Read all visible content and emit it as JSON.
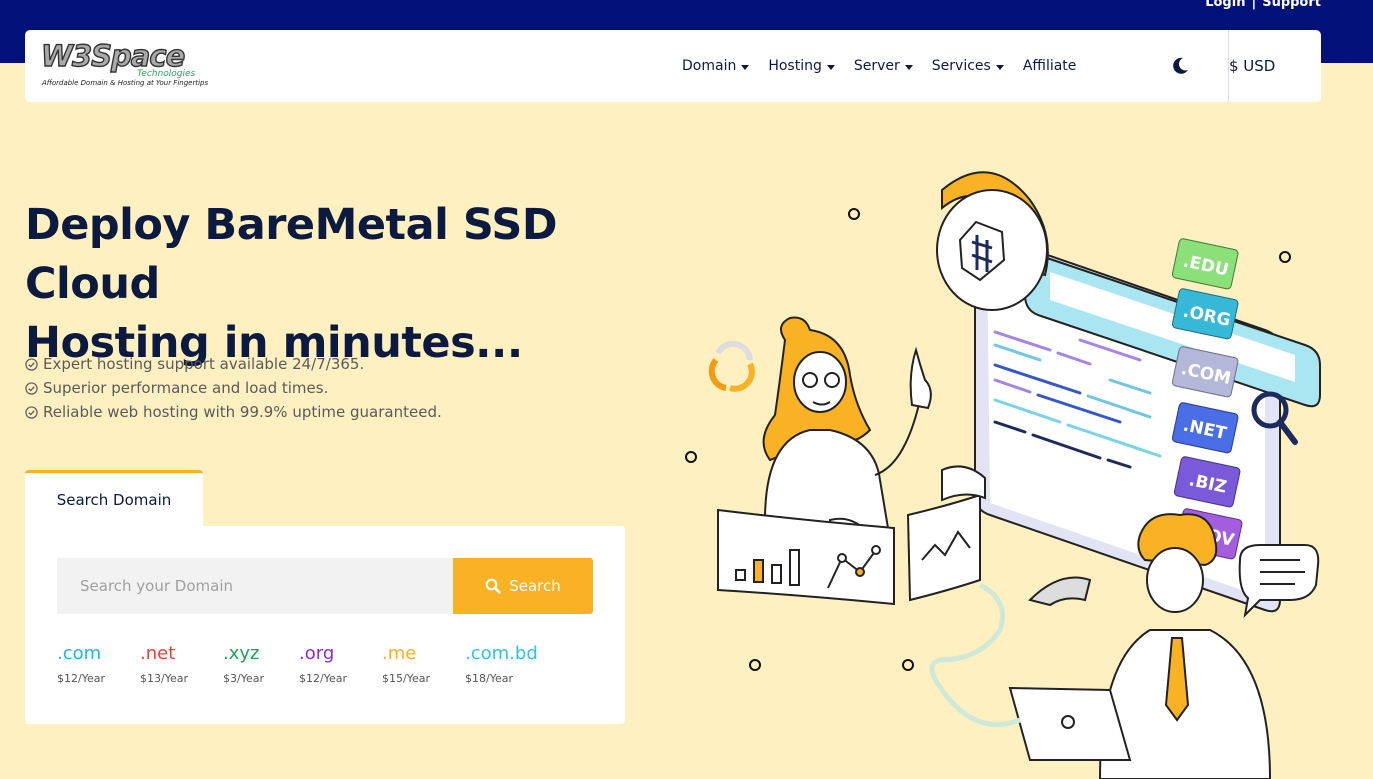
{
  "top_links": {
    "login": "Login",
    "separator": "|",
    "support": "Support"
  },
  "logo": {
    "main": "W3Space",
    "sub": "Technologies",
    "tagline": "Affordable Domain & Hosting at Your Fingertips"
  },
  "nav": {
    "items": [
      {
        "label": "Domain",
        "dropdown": true
      },
      {
        "label": "Hosting",
        "dropdown": true
      },
      {
        "label": "Server",
        "dropdown": true
      },
      {
        "label": "Services",
        "dropdown": true
      },
      {
        "label": "Affiliate",
        "dropdown": false
      }
    ],
    "theme_icon": "moon-icon",
    "currency": "$ USD"
  },
  "hero": {
    "title_line1": "Deploy BareMetal SSD Cloud",
    "title_line2": "Hosting in minutes...",
    "features": [
      "Expert hosting support available 24/7/365.",
      "Superior performance and load times.",
      "Reliable web hosting with 99.9% uptime guaranteed."
    ]
  },
  "search": {
    "tab_label": "Search Domain",
    "placeholder": "Search your Domain",
    "button_label": "Search",
    "tlds": [
      {
        "name": ".com",
        "price": "$12/Year",
        "color": "#1fb6e8"
      },
      {
        "name": ".net",
        "price": "$13/Year",
        "color": "#e8423a"
      },
      {
        "name": ".xyz",
        "price": "$3/Year",
        "color": "#1ea35a"
      },
      {
        "name": ".org",
        "price": "$12/Year",
        "color": "#8a2be2"
      },
      {
        "name": ".me",
        "price": "$15/Year",
        "color": "#f9b223"
      },
      {
        "name": ".com.bd",
        "price": "$18/Year",
        "color": "#2ec5e0"
      }
    ]
  },
  "illustration": {
    "domain_tags": [
      ".EDU",
      ".ORG",
      ".COM",
      ".NET",
      ".BIZ",
      ".GOV"
    ]
  },
  "colors": {
    "top_bar": "#02117a",
    "page_bg": "#fff0c2",
    "accent": "#f9b223",
    "heading": "#0b1a3e"
  }
}
